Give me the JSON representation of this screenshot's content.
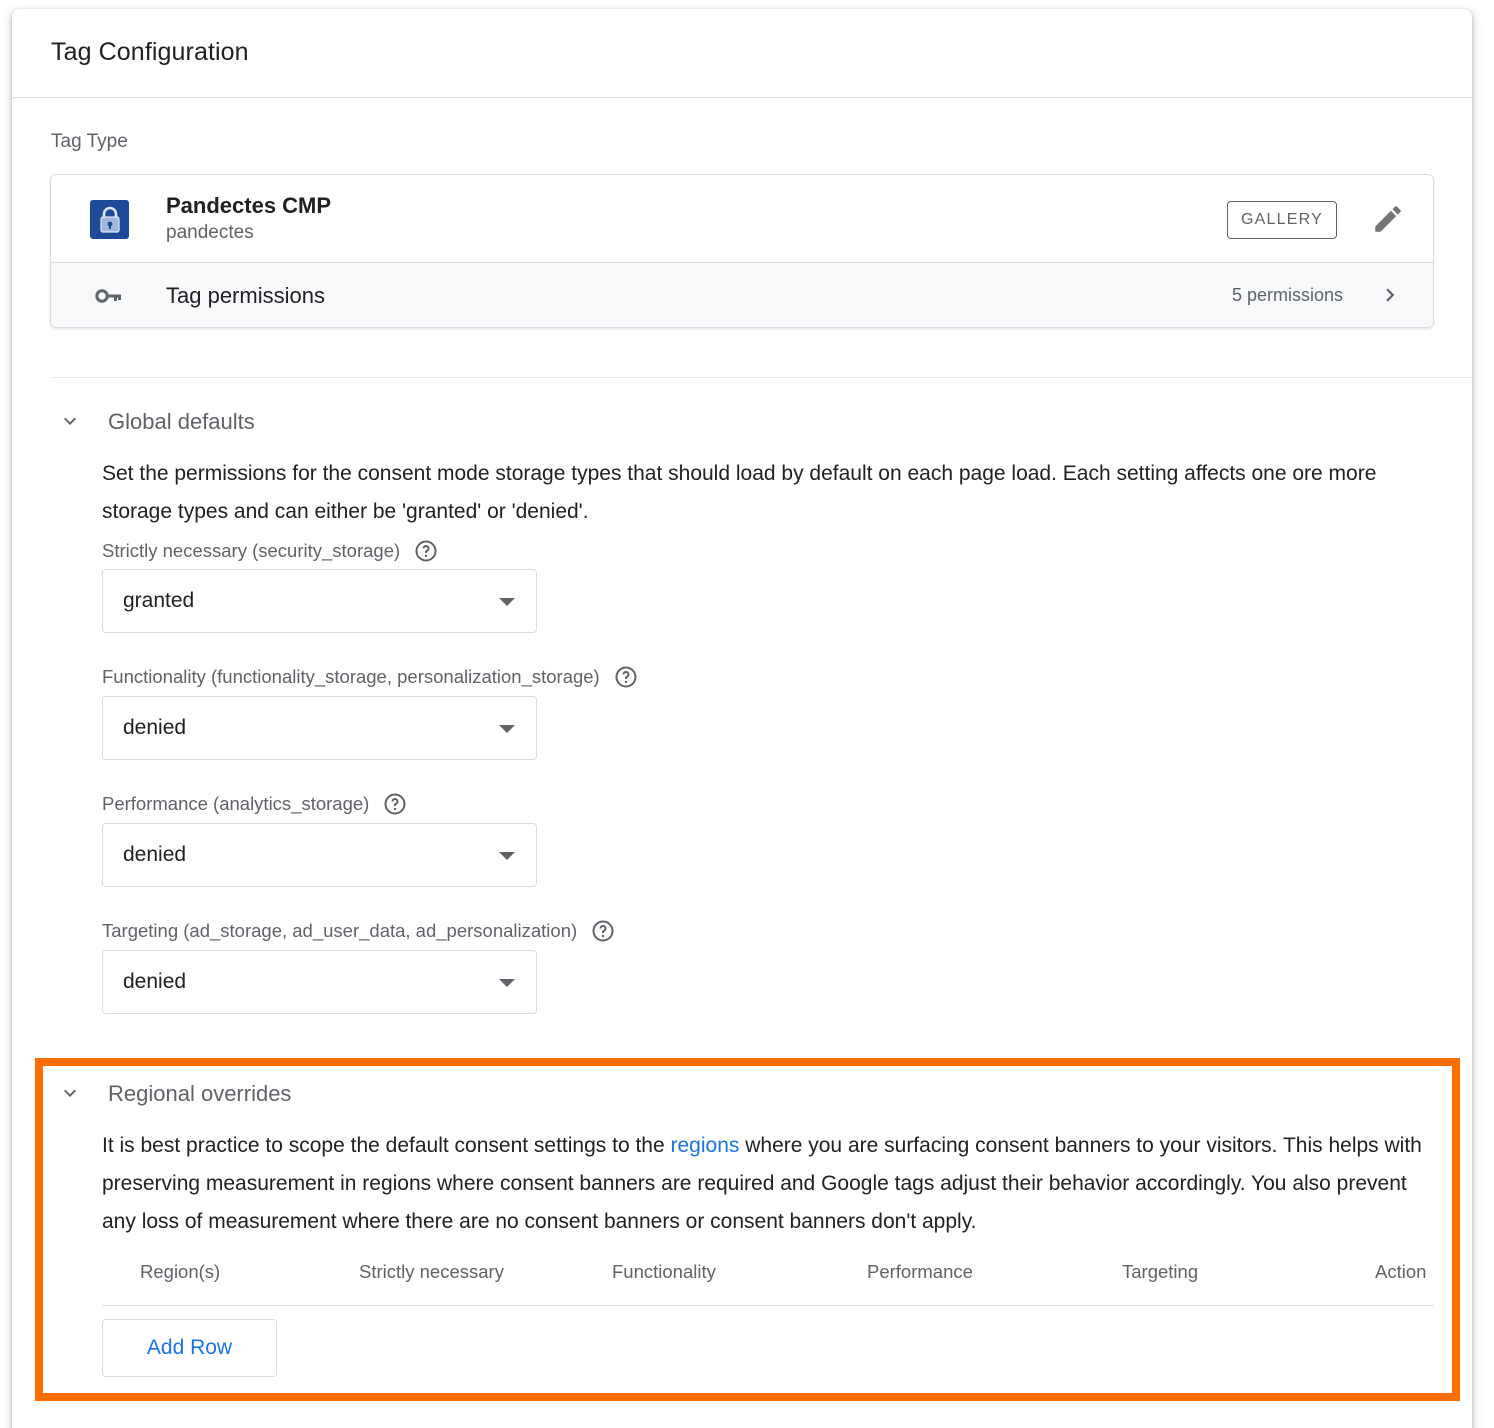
{
  "card": {
    "title": "Tag Configuration",
    "tag_type_label": "Tag Type"
  },
  "tag": {
    "name": "Pandectes CMP",
    "vendor": "pandectes",
    "gallery_label": "GALLERY",
    "permissions_label": "Tag permissions",
    "permissions_count": "5 permissions",
    "logo_icon": "padlock-icon",
    "logo_color": "#1e4a9a"
  },
  "global_defaults": {
    "title": "Global defaults",
    "description": "Set the permissions for the consent mode storage types that should load by default on each page load. Each setting affects one ore more storage types and can either be 'granted' or 'denied'.",
    "fields": [
      {
        "label": "Strictly necessary (security_storage)",
        "value": "granted"
      },
      {
        "label": "Functionality (functionality_storage, personalization_storage)",
        "value": "denied"
      },
      {
        "label": "Performance (analytics_storage)",
        "value": "denied"
      },
      {
        "label": "Targeting (ad_storage, ad_user_data, ad_personalization)",
        "value": "denied"
      }
    ]
  },
  "regional_overrides": {
    "title": "Regional overrides",
    "desc_before_link": "It is best practice to scope the default consent settings to the ",
    "link_text": "regions",
    "desc_after_link": " where you are surfacing consent banners to your visitors. This helps with preserving measurement in regions where consent banners are required and Google tags adjust their behavior accordingly. You also prevent any loss of measurement where there are no consent banners or consent banners don't apply.",
    "columns": [
      "Region(s)",
      "Strictly necessary",
      "Functionality",
      "Performance",
      "Targeting",
      "Action"
    ],
    "add_row_label": "Add Row"
  },
  "colors": {
    "accent": "#1a73e8",
    "highlight": "#ff6d00",
    "muted_text": "#5f6368"
  }
}
